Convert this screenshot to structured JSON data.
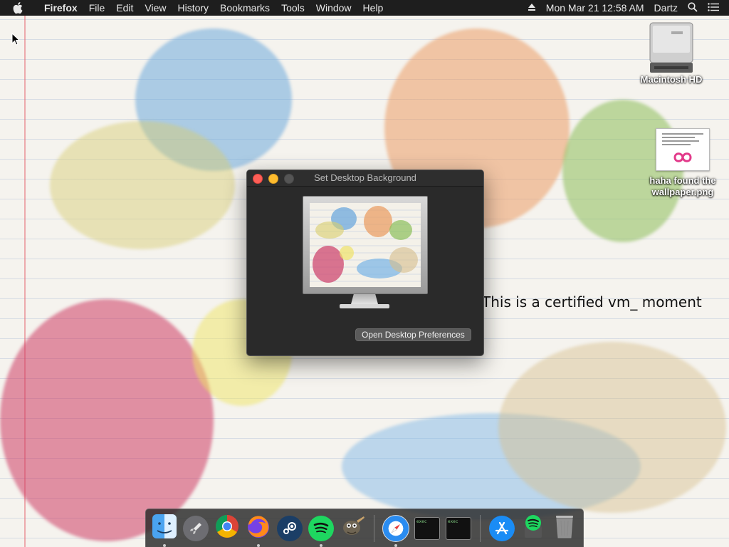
{
  "menubar": {
    "app_name": "Firefox",
    "items": [
      "File",
      "Edit",
      "View",
      "History",
      "Bookmarks",
      "Tools",
      "Window",
      "Help"
    ],
    "clock": "Mon Mar 21  12:58 AM",
    "user": "Dartz"
  },
  "desktop": {
    "icons": [
      {
        "label": "Macintosh HD"
      },
      {
        "label_line1": "haha found the",
        "label_line2": "wallpaper.png"
      }
    ],
    "caption": "This is a certified vm_ moment"
  },
  "window": {
    "title": "Set Desktop Background",
    "button_label": "Open Desktop Preferences"
  },
  "dock": {
    "apps": [
      "Finder",
      "Launchpad",
      "Google Chrome",
      "Firefox",
      "Steam",
      "Spotify",
      "GIMP",
      "Safari",
      "Terminal",
      "Terminal",
      "App Store",
      "Spotify Installer",
      "Trash"
    ],
    "terminal_text": "exec"
  }
}
